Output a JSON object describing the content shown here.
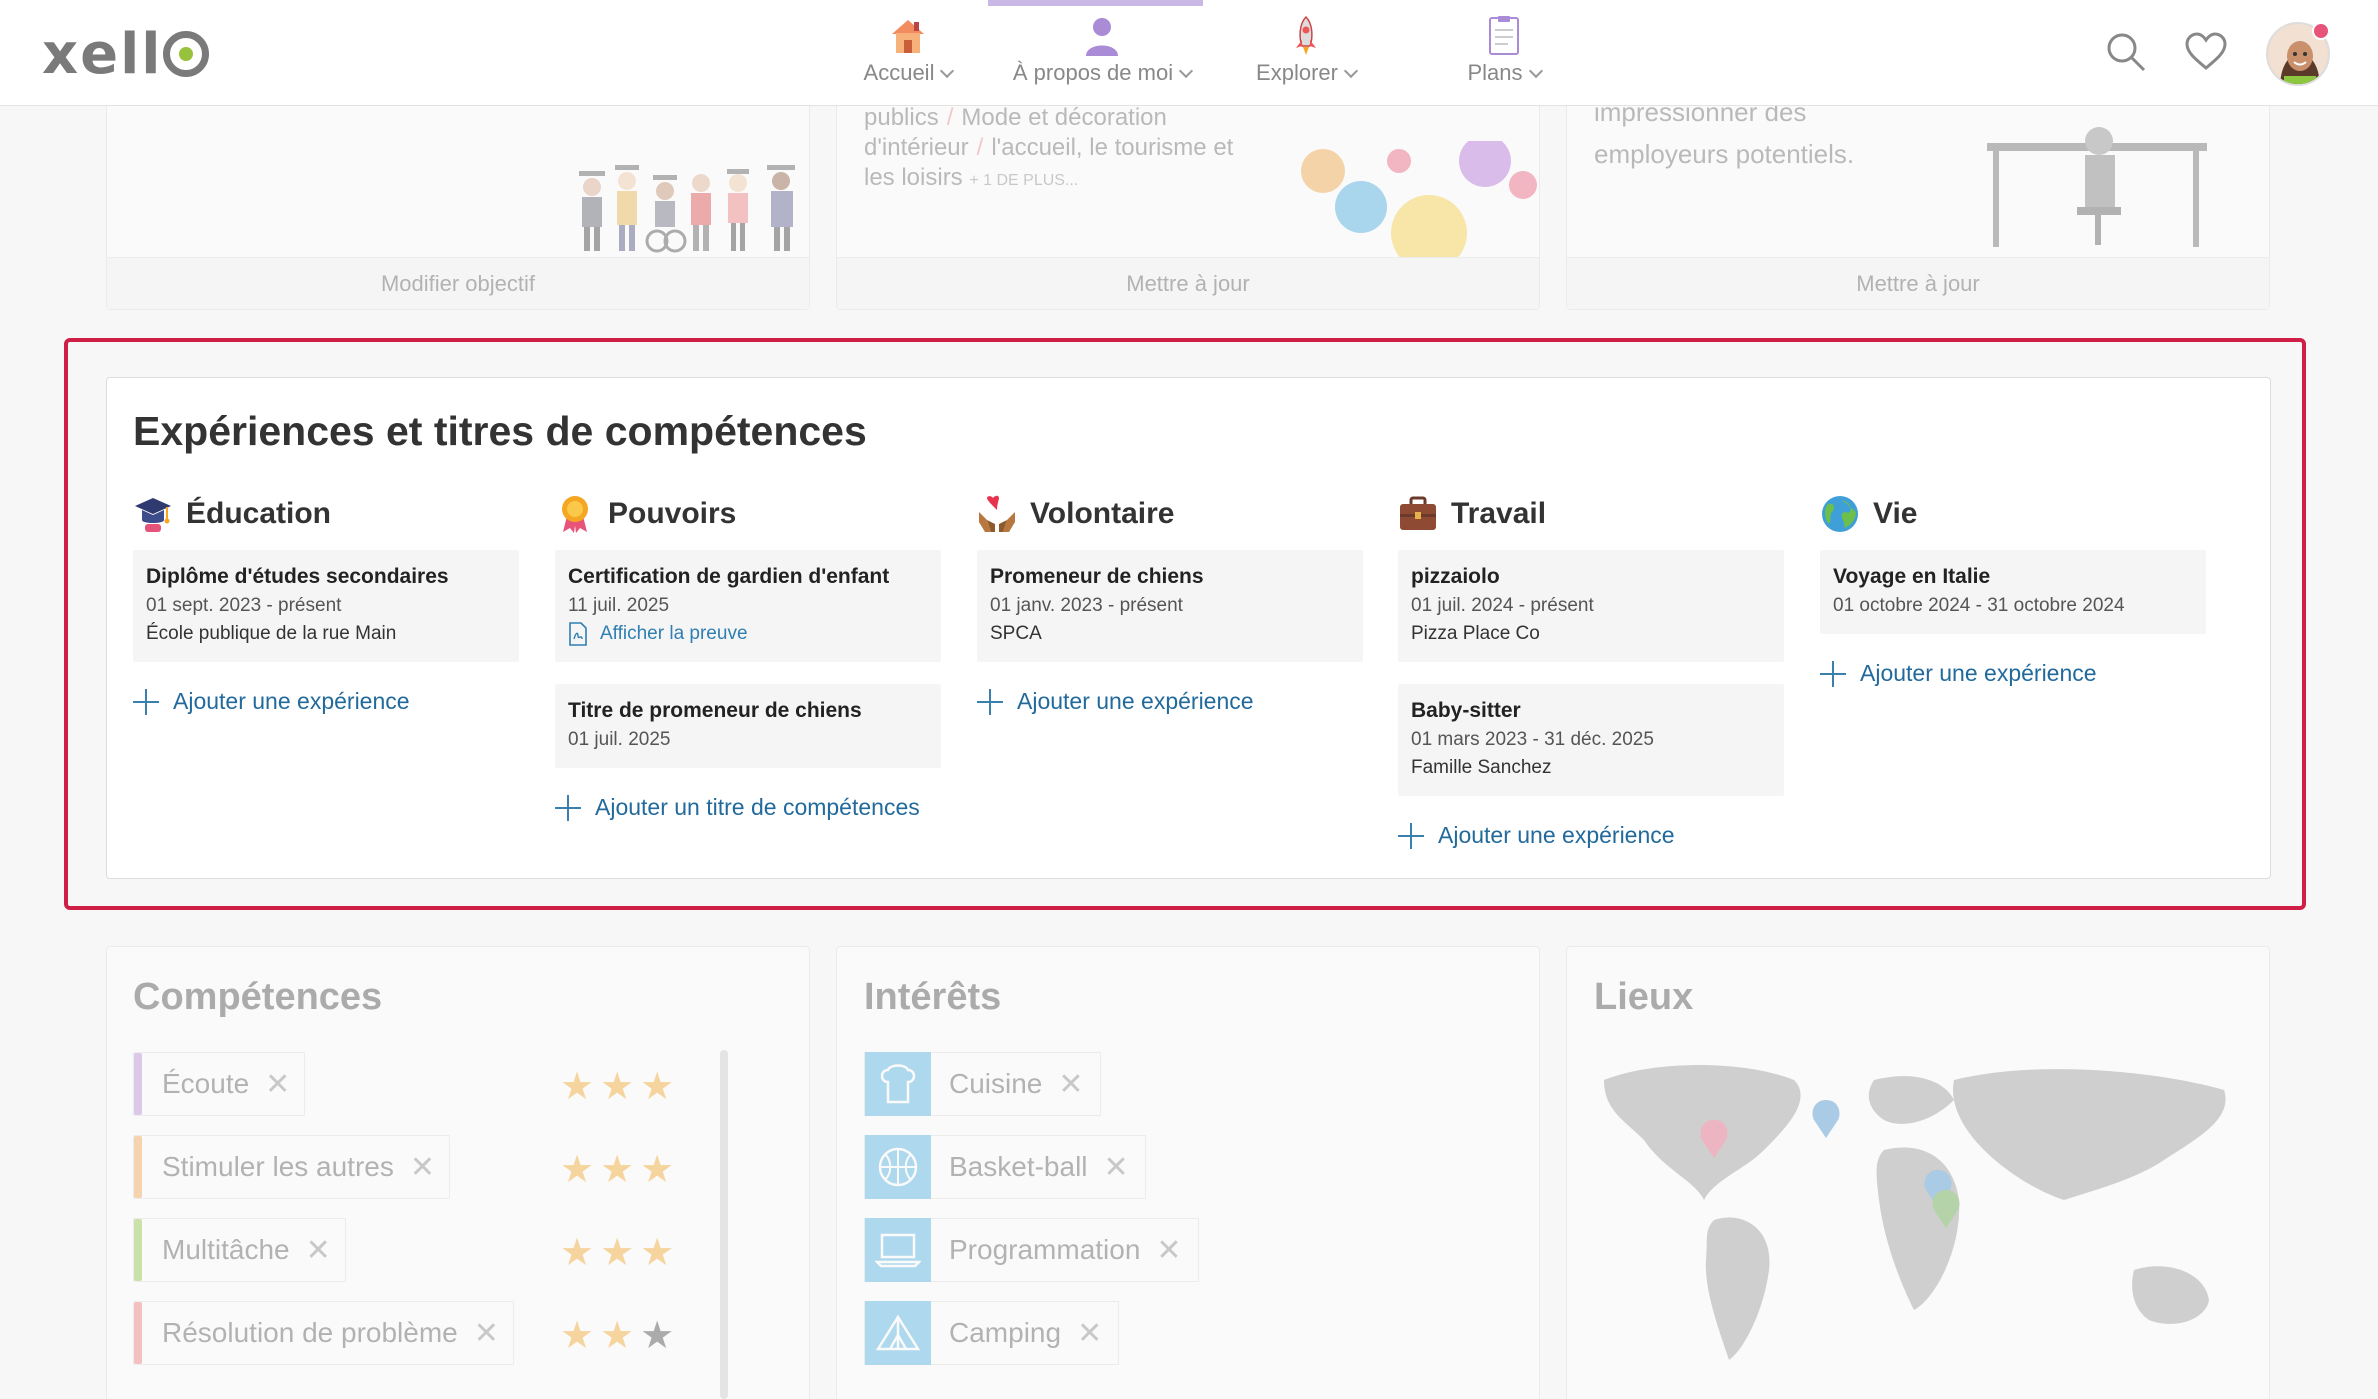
{
  "header": {
    "logo": "xello",
    "nav": [
      {
        "label": "Accueil",
        "icon": "house-icon"
      },
      {
        "label": "À propos de moi",
        "icon": "person-icon"
      },
      {
        "label": "Explorer",
        "icon": "rocket-icon"
      },
      {
        "label": "Plans",
        "icon": "clipboard-icon"
      }
    ],
    "icons": [
      "search-icon",
      "heart-icon",
      "avatar"
    ]
  },
  "top_cards": [
    {
      "footer": "Modifier objectif"
    },
    {
      "text_parts": [
        "publics",
        "Mode et décoration",
        "d'intérieur",
        "l'accueil, le tourisme et",
        "les loisirs"
      ],
      "more": "+ 1 DE PLUS...",
      "footer": "Mettre à jour"
    },
    {
      "text_parts": [
        "impressionner des",
        "employeurs potentiels."
      ],
      "footer": "Mettre à jour"
    }
  ],
  "experiences": {
    "title": "Expériences et titres de compétences",
    "columns": [
      {
        "label": "Éducation",
        "icon": "graduation-cap-icon",
        "entries": [
          {
            "title": "Diplôme d'études secondaires",
            "date": "01 sept. 2023 - présent",
            "org": "École publique de la rue Main"
          }
        ],
        "add_label": "Ajouter une expérience"
      },
      {
        "label": "Pouvoirs",
        "icon": "award-icon",
        "entries": [
          {
            "title": "Certification de gardien d'enfant",
            "date": "11 juil. 2025",
            "link": "Afficher la preuve"
          },
          {
            "title": "Titre de promeneur de chiens",
            "date": "01 juil. 2025"
          }
        ],
        "add_label": "Ajouter un titre de compétences"
      },
      {
        "label": "Volontaire",
        "icon": "hands-heart-icon",
        "entries": [
          {
            "title": "Promeneur de chiens",
            "date": "01 janv. 2023 - présent",
            "org": "SPCA"
          }
        ],
        "add_label": "Ajouter une expérience"
      },
      {
        "label": "Travail",
        "icon": "briefcase-icon",
        "entries": [
          {
            "title": "pizzaiolo",
            "date": "01 juil. 2024 - présent",
            "org": "Pizza Place Co"
          },
          {
            "title": "Baby-sitter",
            "date": "01 mars 2023 - 31 déc. 2025",
            "org": "Famille Sanchez"
          }
        ],
        "add_label": "Ajouter une expérience"
      },
      {
        "label": "Vie",
        "icon": "globe-icon",
        "entries": [
          {
            "title": "Voyage en Italie",
            "date": "01 octobre 2024 - 31 octobre 2024"
          }
        ],
        "add_label": "Ajouter une expérience"
      }
    ]
  },
  "skills": {
    "title": "Compétences",
    "items": [
      {
        "label": "Écoute",
        "color": "#b98ad8",
        "stars": 3
      },
      {
        "label": "Stimuler les autres",
        "color": "#f3a24a",
        "stars": 3
      },
      {
        "label": "Multitâche",
        "color": "#8dc63f",
        "stars": 3
      },
      {
        "label": "Résolution de problème",
        "color": "#f07878",
        "stars": 2
      }
    ]
  },
  "interests": {
    "title": "Intérêts",
    "items": [
      {
        "label": "Cuisine",
        "icon": "chef-icon"
      },
      {
        "label": "Basket-ball",
        "icon": "basketball-icon"
      },
      {
        "label": "Programmation",
        "icon": "laptop-icon"
      },
      {
        "label": "Camping",
        "icon": "tent-icon"
      }
    ]
  },
  "places": {
    "title": "Lieux"
  }
}
